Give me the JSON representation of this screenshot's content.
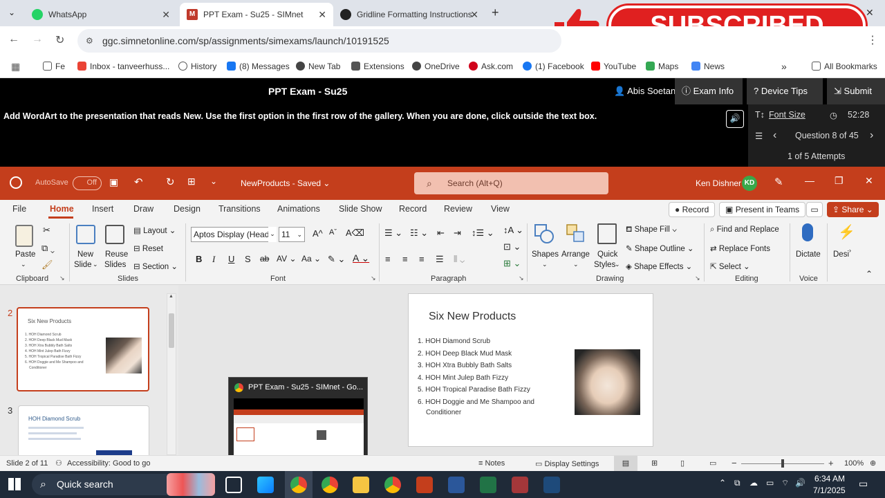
{
  "browser": {
    "tabs": [
      {
        "label": "WhatsApp",
        "color": "#25d366"
      },
      {
        "label": "PPT Exam - Su25 - SIMnet",
        "color": "#c0392b",
        "active": true
      },
      {
        "label": "Gridline Formatting Instructions",
        "color": "#222222"
      }
    ],
    "url": "ggc.simnetonline.com/sp/assignments/simexams/launch/10191525",
    "bookmarks": [
      "Fe",
      "Inbox - tanveerhuss...",
      "History",
      "(8) Messages",
      "New Tab",
      "Extensions",
      "OneDrive",
      "Ask.com",
      "(1) Facebook",
      "YouTube",
      "Maps",
      "News"
    ],
    "all_bookmarks": "All Bookmarks",
    "overlay_text": "SUBSCRIBED"
  },
  "exam": {
    "title": "PPT Exam - Su25",
    "user": "Abis Soetan",
    "exam_info": "Exam Info",
    "device_tips": "Device Tips",
    "submit": "Submit",
    "instruction_prefix": "Add WordArt to the presentation that reads ",
    "instruction_bold": "New",
    "instruction_suffix": ". Use the first option in the first row of the gallery. When you are done, click outside the text box.",
    "font_size": "Font Size",
    "timer": "52:28",
    "question": "Question 8 of 45",
    "attempts": "1 of 5 Attempts"
  },
  "ppt": {
    "autosave": "AutoSave",
    "autosave_state": "Off",
    "filename": "NewProducts - Saved",
    "search_placeholder": "Search (Alt+Q)",
    "user": "Ken Dishner",
    "initials": "KD",
    "tabs": [
      "File",
      "Home",
      "Insert",
      "Draw",
      "Design",
      "Transitions",
      "Animations",
      "Slide Show",
      "Record",
      "Review",
      "View"
    ],
    "record": "Record",
    "present": "Present in Teams",
    "share": "Share",
    "ribbon": {
      "paste": "Paste",
      "clipboard": "Clipboard",
      "new_slide_1": "New",
      "new_slide_2": "Slide",
      "reuse_1": "Reuse",
      "reuse_2": "Slides",
      "layout": "Layout",
      "reset": "Reset",
      "section": "Section",
      "slides": "Slides",
      "font_name": "Aptos Display (Headings)",
      "font_size": "11",
      "font": "Font",
      "paragraph": "Paragraph",
      "shapes": "Shapes",
      "arrange": "Arrange",
      "quick_styles_1": "Quick",
      "quick_styles_2": "Styles",
      "shape_fill": "Shape Fill",
      "shape_outline": "Shape Outline",
      "shape_effects": "Shape Effects",
      "drawing": "Drawing",
      "find_replace": "Find and Replace",
      "replace_fonts": "Replace Fonts",
      "select": "Select",
      "editing": "Editing",
      "dictate": "Dictate",
      "voice": "Voice",
      "designer": "Desi"
    },
    "slide": {
      "title": "Six New Products",
      "items": [
        "1. HOH Diamond Scrub",
        "2. HOH Deep Black Mud Mask",
        "3. HOH Xtra Bubbly Bath Salts",
        "4. HOH Mint Julep Bath Fizzy",
        "5. HOH Tropical Paradise Bath Fizzy",
        "6. HOH Doggie and Me Shampoo and"
      ],
      "item6_cont": "Conditioner"
    },
    "thumb2_num": "2",
    "thumb3_num": "3",
    "thumb3_title": "HOH Diamond Scrub",
    "popup_title": "PPT Exam - Su25 - SIMnet - Go...",
    "status_slide": "Slide 2 of 11",
    "accessibility": "Accessibility: Good to go",
    "notes": "Notes",
    "display_settings": "Display Settings",
    "zoom": "100%"
  },
  "taskbar": {
    "search": "Quick search",
    "time": "6:34 AM",
    "date": "7/1/2025"
  }
}
